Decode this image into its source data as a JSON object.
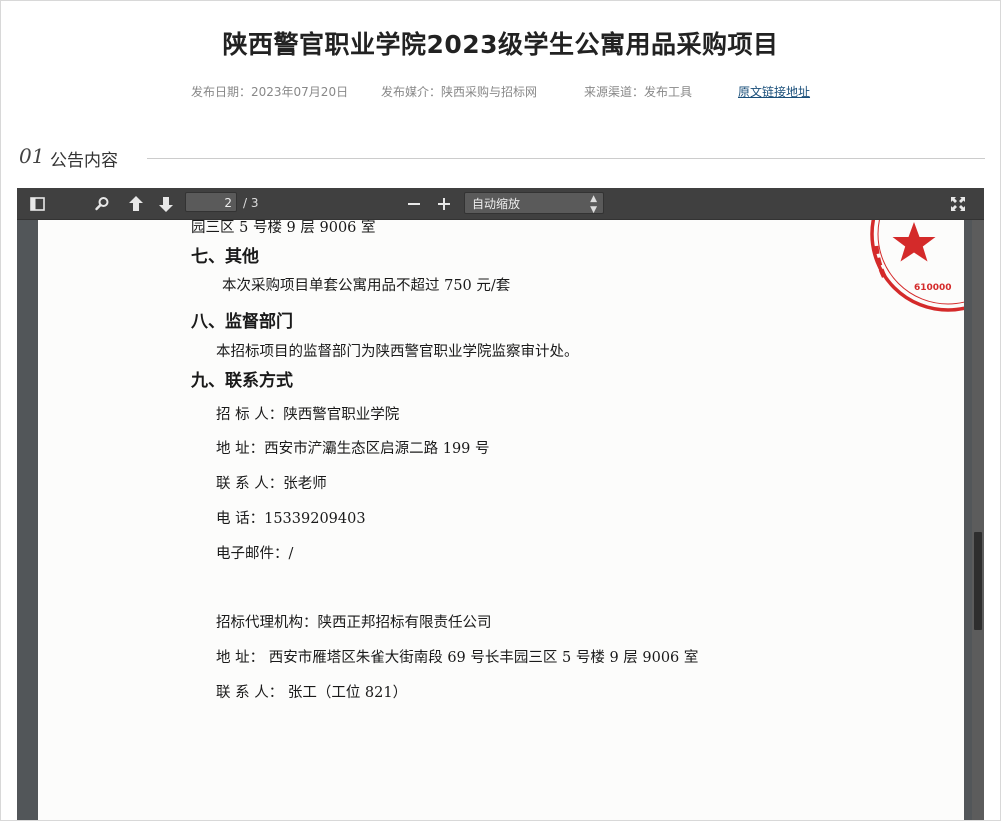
{
  "header": {
    "title": "陕西警官职业学院2023级学生公寓用品采购项目",
    "publish_date": "发布日期：2023年07月20日",
    "publish_media": "发布媒介：陕西采购与招标网",
    "source_channel": "来源渠道：发布工具",
    "original_link": "原文链接地址"
  },
  "section": {
    "number": "01",
    "label": "公告内容"
  },
  "pdf_viewer": {
    "current_page": "2",
    "total_pages": "/ 3",
    "zoom": "自动缩放",
    "icons": [
      "sidebar-toggle-icon",
      "search-icon",
      "arrow-up-icon",
      "arrow-down-icon",
      "minus-icon",
      "plus-icon",
      "fullscreen-icon"
    ],
    "toolbar_color": "#404040",
    "background_color": "#525659"
  },
  "document": {
    "top_line": "园三区 5 号楼 9 层 9006 室",
    "s7_title": "七、其他",
    "s7_text": "本次采购项目单套公寓用品不超过 750 元/套",
    "s8_title": "八、监督部门",
    "s8_text": "本招标项目的监督部门为陕西警官职业学院监察审计处。",
    "s9_title": "九、联系方式",
    "tenderer": "招  标  人：陕西警官职业学院",
    "address": "地        址：西安市浐灞生态区启源二路 199 号",
    "contact": "联  系  人：张老师",
    "phone": "电        话：15339209403",
    "email": "电子邮件：/",
    "agency": "招标代理机构：陕西正邦招标有限责任公司",
    "agency_address": "地        址：  西安市雁塔区朱雀大街南段 69 号长丰园三区 5 号楼 9 层 9006 室",
    "agency_contact": "联  系  人：  张工（工位 821）",
    "stamp_text": "610000",
    "stamp_color": "#d42a2a"
  }
}
